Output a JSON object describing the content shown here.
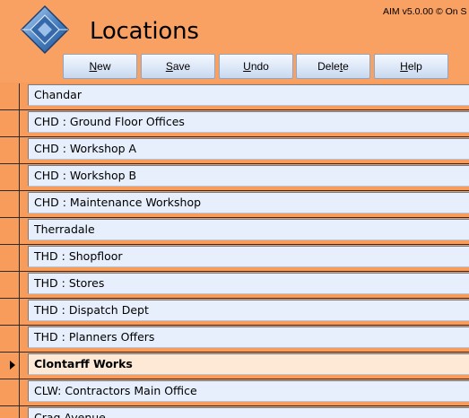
{
  "app": {
    "title": "Locations",
    "version": "AIM v5.0.00 © On S"
  },
  "toolbar": {
    "buttons": [
      {
        "name": "new-button",
        "mnemonic": "N",
        "rest": "ew"
      },
      {
        "name": "save-button",
        "mnemonic": "S",
        "rest": "ave"
      },
      {
        "name": "undo-button",
        "mnemonic": "U",
        "rest": "ndo"
      },
      {
        "name": "delete-button",
        "pre": "Dele",
        "mnemonic": "t",
        "rest": "e"
      },
      {
        "name": "help-button",
        "mnemonic": "H",
        "rest": "elp"
      }
    ]
  },
  "colors": {
    "background": "#F89C5B",
    "field": "#E6EFFB",
    "current_field": "#FDE9D6",
    "button": "#DCE7F7"
  },
  "locations": [
    {
      "label": "Chandar"
    },
    {
      "label": "CHD : Ground Floor Offices"
    },
    {
      "label": "CHD : Workshop A"
    },
    {
      "label": "CHD : Workshop B"
    },
    {
      "label": "CHD : Maintenance Workshop"
    },
    {
      "label": "Therradale"
    },
    {
      "label": "THD : Shopfloor"
    },
    {
      "label": "THD : Stores"
    },
    {
      "label": "THD : Dispatch Dept"
    },
    {
      "label": "THD : Planners Offers"
    },
    {
      "label": "Clontarff Works",
      "current": true
    },
    {
      "label": "CLW: Contractors Main Office"
    },
    {
      "label": "Crag Avenue"
    }
  ]
}
